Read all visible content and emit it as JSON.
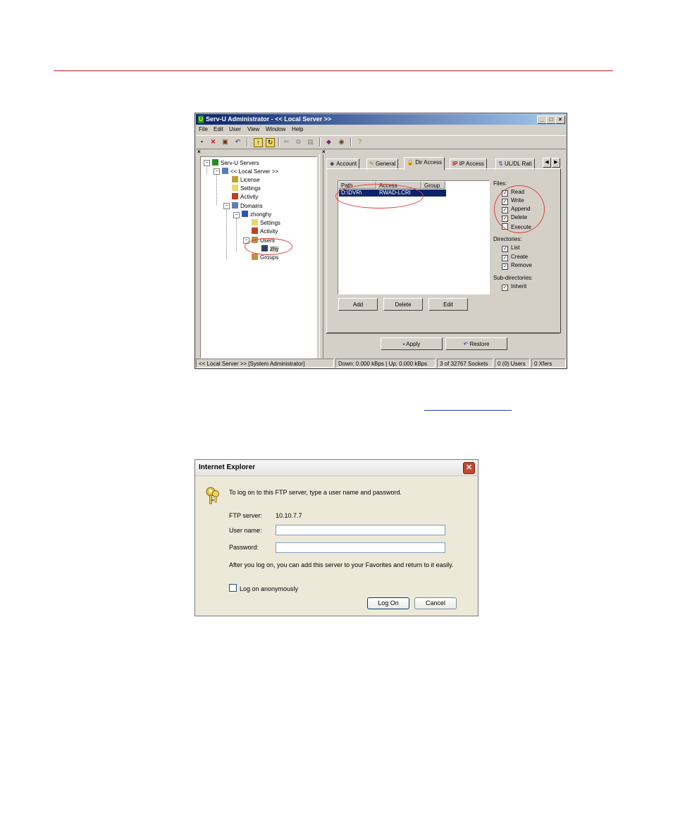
{
  "servu": {
    "title": "Serv-U Administrator - << Local Server >>",
    "menu": [
      "File",
      "Edit",
      "User",
      "View",
      "Window",
      "Help"
    ],
    "tree": {
      "root": "Serv-U Servers",
      "server": "<< Local Server >>",
      "license": "License",
      "settings": "Settings",
      "activity": "Activity",
      "domains": "Domains",
      "domain_name": "zhonghy",
      "domain_settings": "Settings",
      "domain_activity": "Activity",
      "users": "Users",
      "user": "zhy",
      "groups": "Groups"
    },
    "tabs": [
      "Account",
      "General",
      "Dir Access",
      "IP Access",
      "UL/DL Rati"
    ],
    "list": {
      "headers": [
        "Path",
        "Access",
        "Group"
      ],
      "rows": [
        {
          "path": "D:\\DVR\\",
          "access": "RWAD-LCRI",
          "group": ""
        }
      ]
    },
    "files_label": "Files:",
    "files": [
      "Read",
      "Write",
      "Append",
      "Delete",
      "Execute"
    ],
    "directories_label": "Directories:",
    "directories": [
      "List",
      "Create",
      "Remove"
    ],
    "subdirectories_label": "Sub-directories:",
    "subdirectories": [
      "Inherit"
    ],
    "buttons": {
      "add": "Add",
      "delete": "Delete",
      "edit": "Edit",
      "apply": "Apply",
      "restore": "Restore"
    },
    "status": [
      "<< Local Server >>   [System Administrator]",
      "Down: 0.000 kBps | Up: 0.000 kBps",
      "3 of 32767 Sockets",
      "0 (0) Users",
      "0 Xfers"
    ]
  },
  "ie": {
    "title": "Internet Explorer",
    "prompt": "To log on to this FTP server, type a user name and password.",
    "server_label": "FTP server:",
    "server_value": "10.10.7.7",
    "user_label": "User name:",
    "password_label": "Password:",
    "note": "After you log on, you can add this server to your Favorites and return to it easily.",
    "anon_label": "Log on anonymously",
    "logon": "Log On",
    "cancel": "Cancel"
  }
}
